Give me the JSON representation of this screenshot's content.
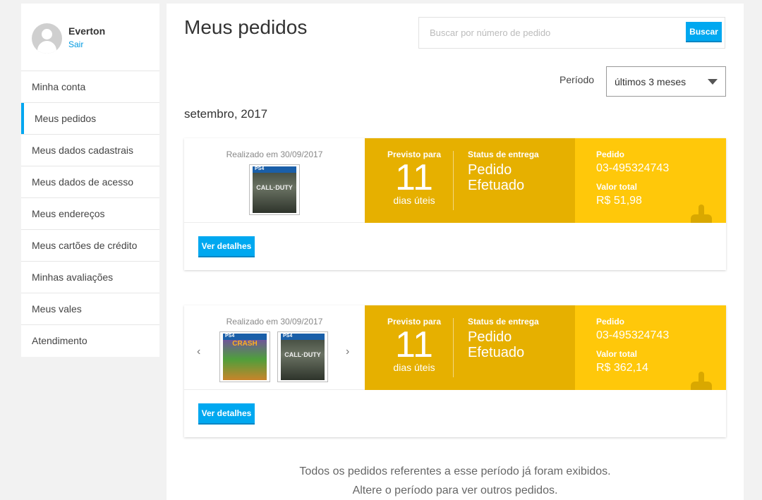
{
  "user": {
    "name": "Everton",
    "logout_label": "Sair"
  },
  "sidebar": {
    "items": [
      {
        "label": "Minha conta"
      },
      {
        "label": "Meus pedidos",
        "active": true
      },
      {
        "label": "Meus dados cadastrais"
      },
      {
        "label": "Meus dados de acesso"
      },
      {
        "label": "Meus endereços"
      },
      {
        "label": "Meus cartões de crédito"
      },
      {
        "label": "Minhas avaliações"
      },
      {
        "label": "Meus vales"
      },
      {
        "label": "Atendimento"
      }
    ]
  },
  "header": {
    "title": "Meus pedidos",
    "search_placeholder": "Buscar por número de pedido",
    "search_button": "Buscar"
  },
  "filter": {
    "period_label": "Período",
    "period_value": "últimos 3 meses"
  },
  "month_heading": "setembro, 2017",
  "orders": [
    {
      "date_text": "Realizado em 30/09/2017",
      "products": [
        {
          "platform": "PS4",
          "title": "CALL·DUTY"
        }
      ],
      "forecast_label": "Previsto para",
      "forecast_days": "11",
      "forecast_unit": "dias úteis",
      "status_label": "Status de entrega",
      "status_value": "Pedido Efetuado",
      "order_label": "Pedido",
      "order_number": "03-495324743",
      "total_label": "Valor total",
      "total_value": "R$ 51,98",
      "details_button": "Ver detalhes"
    },
    {
      "date_text": "Realizado em 30/09/2017",
      "products": [
        {
          "platform": "PS4",
          "title": "CRASH"
        },
        {
          "platform": "PS4",
          "title": "CALL·DUTY"
        }
      ],
      "prev_arrow": "‹",
      "next_arrow": "›",
      "forecast_label": "Previsto para",
      "forecast_days": "11",
      "forecast_unit": "dias úteis",
      "status_label": "Status de entrega",
      "status_value": "Pedido Efetuado",
      "order_label": "Pedido",
      "order_number": "03-495324743",
      "total_label": "Valor total",
      "total_value": "R$ 362,14",
      "details_button": "Ver detalhes"
    }
  ],
  "footer": {
    "line1": "Todos os pedidos referentes a esse período já foram exibidos.",
    "line2": "Altere o período para ver outros pedidos."
  },
  "colors": {
    "accent": "#00a8f0",
    "status_bg": "#e6b000",
    "info_bg": "#ffc80a"
  },
  "icons": [
    "user-avatar-icon",
    "chevron-down-icon",
    "chevron-left-icon",
    "chevron-right-icon",
    "order-decor-icon"
  ]
}
